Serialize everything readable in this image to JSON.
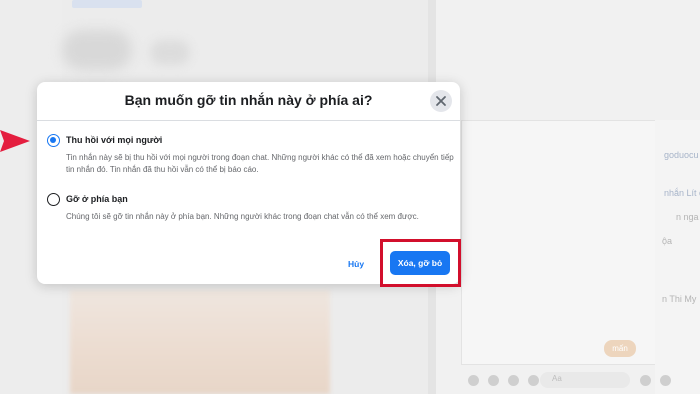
{
  "dialog": {
    "title": "Bạn muốn gỡ tin nhắn này ở phía ai?",
    "options": [
      {
        "label": "Thu hồi với mọi người",
        "description": "Tin nhắn này sẽ bị thu hồi với mọi người trong đoạn chat. Những người khác có thể đã xem hoặc chuyển tiếp tin nhắn đó. Tin nhắn đã thu hồi vẫn có thể bị báo cáo.",
        "selected": true
      },
      {
        "label": "Gỡ ở phía bạn",
        "description": "Chúng tôi sẽ gỡ tin nhắn này ở phía bạn. Những người khác trong đoạn chat vẫn có thể xem được.",
        "selected": false
      }
    ],
    "cancel_label": "Hủy",
    "confirm_label": "Xóa, gỡ bỏ"
  },
  "background": {
    "snippets": [
      "goduocu",
      "nhắn Lít cả",
      "n nga",
      "ộa",
      "n Thi My",
      "Aa"
    ],
    "chip_label": "mấn"
  },
  "colors": {
    "accent": "#1877f2",
    "annotation_red": "#d20f2c",
    "text_primary": "#1c1e21",
    "text_secondary": "#65676b"
  },
  "icons": [
    "close-icon",
    "red-arrow-icon",
    "radio-selected-icon",
    "radio-empty-icon"
  ]
}
